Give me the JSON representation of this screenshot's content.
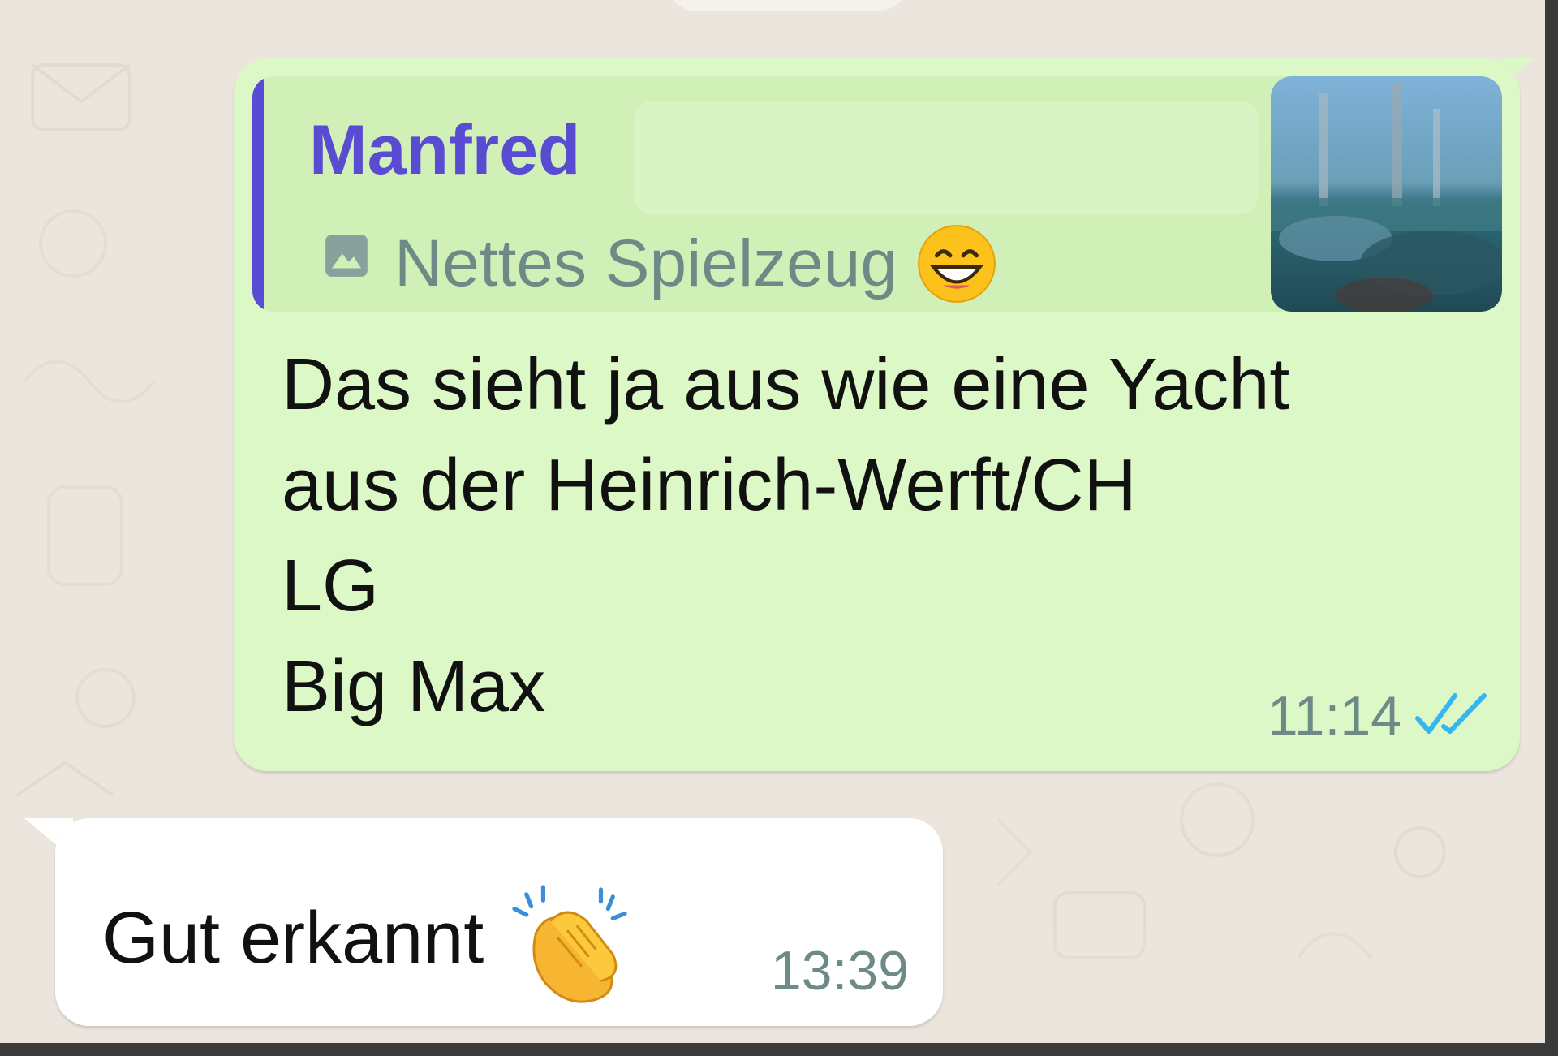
{
  "outgoing_message": {
    "quote": {
      "sender": "Manfred",
      "text": "Nettes Spielzeug",
      "text_emoji": "grinning-face-emoji",
      "media_icon": "image-icon",
      "thumbnail": "blurred-yacht-photo"
    },
    "lines": [
      "Das sieht ja aus wie eine Yacht",
      "aus der Heinrich-Werft/CH",
      "LG",
      "Big Max"
    ],
    "time": "11:14",
    "status": "read",
    "status_icon": "double-check-icon"
  },
  "incoming_message": {
    "text": "Gut erkannt",
    "emoji": "clapping-hands-emoji",
    "time": "13:39"
  },
  "colors": {
    "background": "#ece5dd",
    "outgoing_bubble": "#dcf8c6",
    "quote_box": "#d1f0b8",
    "quote_accent": "#5a4bd3",
    "meta_text": "#6e8a86",
    "read_ticks": "#34b7f1",
    "incoming_bubble": "#ffffff"
  }
}
